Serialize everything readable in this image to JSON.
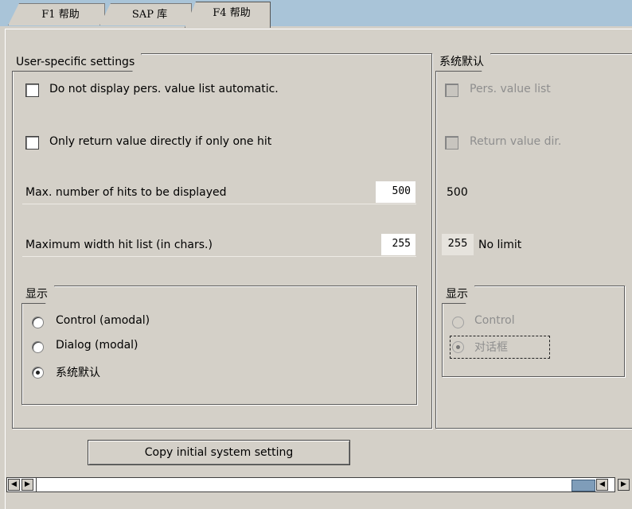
{
  "tabs": [
    {
      "label": "F1 帮助"
    },
    {
      "label": "SAP 库"
    },
    {
      "label": "F4 帮助"
    }
  ],
  "user_settings": {
    "title": "User-specific settings",
    "checkbox1": "Do not display pers. value list automatic.",
    "checkbox2": "Only return value directly if only one hit",
    "max_hits_label": "Max. number of hits to be displayed",
    "max_hits_value": "500",
    "max_width_label": "Maximum width hit list (in chars.)",
    "max_width_value": "255",
    "display_group": {
      "title": "显示",
      "options": [
        "Control (amodal)",
        "Dialog (modal)",
        "系统默认"
      ],
      "selected": "系统默认"
    }
  },
  "system_default": {
    "title": "系统默认",
    "pers_value_list": "Pers. value list",
    "return_value_dir": "Return value dir.",
    "max_hits": "500",
    "max_width": "255",
    "no_limit": "No limit",
    "display_group": {
      "title": "显示",
      "options": [
        "Control",
        "对话框"
      ],
      "selected": "对话框"
    }
  },
  "copy_button": "Copy initial system setting"
}
